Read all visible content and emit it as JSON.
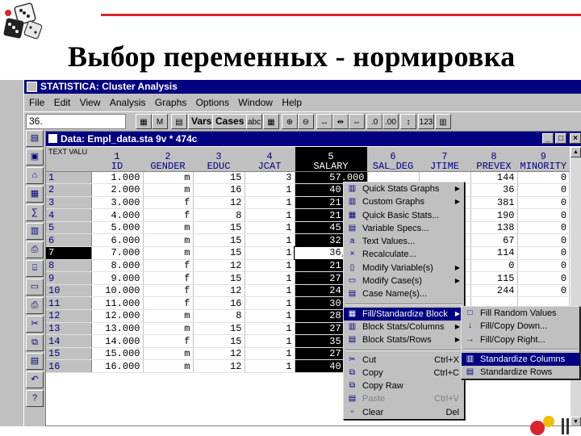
{
  "slide": {
    "title": "Выбор переменных - нормировка"
  },
  "app": {
    "title": "STATISTICA: Cluster Analysis",
    "menu": [
      "File",
      "Edit",
      "View",
      "Analysis",
      "Graphs",
      "Options",
      "Window",
      "Help"
    ],
    "toolbar": {
      "combo_value": "36.",
      "vars_label": "Vars",
      "cases_label": "Cases"
    }
  },
  "sheet": {
    "title": "Data: Empl_data.sta 9v * 474c",
    "corner_label": "TEXT VALU",
    "columns": [
      {
        "num": "1",
        "name": "ID"
      },
      {
        "num": "2",
        "name": "GENDER"
      },
      {
        "num": "3",
        "name": "EDUC"
      },
      {
        "num": "4",
        "name": "JCAT"
      },
      {
        "num": "5",
        "name": "SALARY"
      },
      {
        "num": "6",
        "name": "SAL_DEG"
      },
      {
        "num": "7",
        "name": "JTIME"
      },
      {
        "num": "8",
        "name": "PREVEX"
      },
      {
        "num": "9",
        "name": "MINORITY"
      }
    ],
    "rows": [
      {
        "n": "1",
        "id": "1.000",
        "gender": "m",
        "educ": "15",
        "jcat": "3",
        "salary": "57.000",
        "prevex": "144",
        "minority": "0"
      },
      {
        "n": "2",
        "id": "2.000",
        "gender": "m",
        "educ": "16",
        "jcat": "1",
        "salary": "40.200",
        "prevex": "36",
        "minority": "0"
      },
      {
        "n": "3",
        "id": "3.000",
        "gender": "f",
        "educ": "12",
        "jcat": "1",
        "salary": "21.450",
        "prevex": "381",
        "minority": "0"
      },
      {
        "n": "4",
        "id": "4.000",
        "gender": "f",
        "educ": "8",
        "jcat": "1",
        "salary": "21.900",
        "prevex": "190",
        "minority": "0"
      },
      {
        "n": "5",
        "id": "5.000",
        "gender": "m",
        "educ": "15",
        "jcat": "1",
        "salary": "45.000",
        "prevex": "138",
        "minority": "0"
      },
      {
        "n": "6",
        "id": "6.000",
        "gender": "m",
        "educ": "15",
        "jcat": "1",
        "salary": "32.100",
        "prevex": "67",
        "minority": "0"
      },
      {
        "n": "7",
        "id": "7.000",
        "gender": "m",
        "educ": "15",
        "jcat": "1",
        "salary": "36,000",
        "prevex": "114",
        "minority": "0"
      },
      {
        "n": "8",
        "id": "8.000",
        "gender": "f",
        "educ": "12",
        "jcat": "1",
        "salary": "21.900",
        "prevex": "0",
        "minority": "0"
      },
      {
        "n": "9",
        "id": "9.000",
        "gender": "f",
        "educ": "15",
        "jcat": "1",
        "salary": "27.900",
        "prevex": "115",
        "minority": "0"
      },
      {
        "n": "10",
        "id": "10.000",
        "gender": "f",
        "educ": "12",
        "jcat": "1",
        "salary": "24.000",
        "prevex": "244",
        "minority": "0"
      },
      {
        "n": "11",
        "id": "11.000",
        "gender": "f",
        "educ": "16",
        "jcat": "1",
        "salary": "30.300",
        "prevex": "",
        "minority": ""
      },
      {
        "n": "12",
        "id": "12.000",
        "gender": "m",
        "educ": "8",
        "jcat": "1",
        "salary": "28.350",
        "prevex": "",
        "minority": ""
      },
      {
        "n": "13",
        "id": "13.000",
        "gender": "m",
        "educ": "15",
        "jcat": "1",
        "salary": "27.750",
        "prevex": "",
        "minority": ""
      },
      {
        "n": "14",
        "id": "14.000",
        "gender": "f",
        "educ": "15",
        "jcat": "1",
        "salary": "35.100",
        "prevex": "",
        "minority": ""
      },
      {
        "n": "15",
        "id": "15.000",
        "gender": "m",
        "educ": "12",
        "jcat": "1",
        "salary": "27.300",
        "prevex": "",
        "minority": ""
      },
      {
        "n": "16",
        "id": "16.000",
        "gender": "m",
        "educ": "12",
        "jcat": "1",
        "salary": "40.800",
        "prevex": "",
        "minority": ""
      }
    ]
  },
  "context_menu": {
    "items": [
      {
        "label": "Quick Stats Graphs",
        "icon": "chart-icon",
        "submenu": true
      },
      {
        "label": "Custom Graphs",
        "icon": "bar-chart-icon",
        "submenu": true
      },
      {
        "label": "Quick Basic Stats...",
        "icon": "stats-icon"
      },
      {
        "label": "Variable Specs...",
        "icon": "specs-icon"
      },
      {
        "label": "Text Values...",
        "icon": "abc-icon"
      },
      {
        "label": "Recalculate...",
        "icon": "recalc-icon"
      },
      {
        "label": "Modify Variable(s)",
        "icon": "columns-icon",
        "submenu": true
      },
      {
        "label": "Modify Case(s)",
        "icon": "rows-icon",
        "submenu": true
      },
      {
        "label": "Case Name(s)...",
        "icon": "case-name-icon"
      },
      {
        "label": "Fill/Standardize Block",
        "icon": "fill-icon",
        "submenu": true,
        "highlight": true
      },
      {
        "label": "Block Stats/Columns",
        "icon": "block-columns-icon",
        "submenu": true
      },
      {
        "label": "Block Stats/Rows",
        "icon": "block-rows-icon",
        "submenu": true
      },
      {
        "label": "Cut",
        "icon": "scissors-icon",
        "shortcut": "Ctrl+X"
      },
      {
        "label": "Copy",
        "icon": "copy-icon",
        "shortcut": "Ctrl+C"
      },
      {
        "label": "Copy Raw",
        "icon": "copy-raw-icon"
      },
      {
        "label": "Paste",
        "icon": "paste-icon",
        "shortcut": "Ctrl+V",
        "disabled": true
      },
      {
        "label": "Clear",
        "icon": "clear-icon",
        "shortcut": "Del"
      }
    ]
  },
  "submenu": {
    "items": [
      {
        "label": "Fill Random Values",
        "icon": "random-icon"
      },
      {
        "label": "Fill/Copy Down...",
        "icon": "fill-down-icon"
      },
      {
        "label": "Fill/Copy Right...",
        "icon": "fill-right-icon"
      },
      {
        "label": "Standardize Columns",
        "icon": "standardize-columns-icon",
        "highlight": true
      },
      {
        "label": "Standardize Rows",
        "icon": "standardize-rows-icon"
      }
    ]
  }
}
